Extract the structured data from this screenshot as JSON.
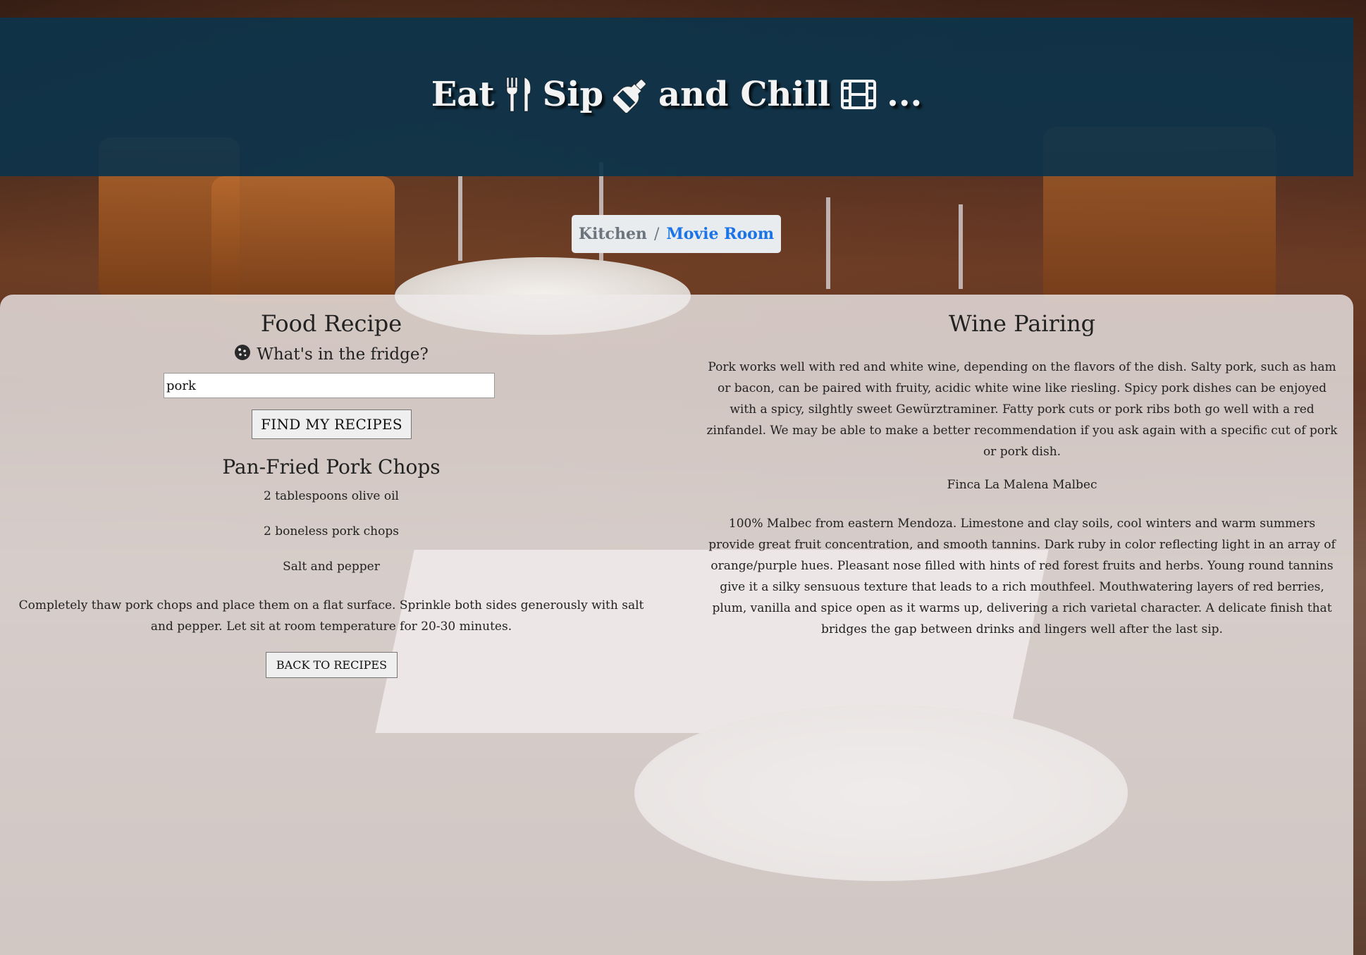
{
  "header": {
    "title_parts": [
      "Eat",
      "Sip",
      "and Chill",
      "..."
    ],
    "icons": [
      "fork-knife-icon",
      "wine-bottle-icon",
      "film-icon"
    ]
  },
  "breadcrumb": {
    "kitchen": "Kitchen",
    "separator": "/",
    "movie_room": "Movie Room"
  },
  "food": {
    "heading": "Food Recipe",
    "fridge_prompt": "What's in the fridge?",
    "search_value": "pork",
    "find_button": "FIND MY RECIPES",
    "recipe_title": "Pan-Fried Pork Chops",
    "ingredients": [
      "2 tablespoons olive oil",
      "2 boneless pork chops",
      "Salt and pepper"
    ],
    "instructions": "Completely thaw pork chops and place them on a flat surface. Sprinkle both sides generously with salt and pepper. Let sit at room temperature for 20-30 minutes.",
    "back_button": "BACK TO RECIPES"
  },
  "wine": {
    "heading": "Wine Pairing",
    "description": "Pork works well with red and white wine, depending on the flavors of the dish. Salty pork, such as ham or bacon, can be paired with fruity, acidic white wine like riesling. Spicy pork dishes can be enjoyed with a spicy, silghtly sweet Gewürztraminer. Fatty pork cuts or pork ribs both go well with a red zinfandel. We may be able to make a better recommendation if you ask again with a specific cut of pork or pork dish.",
    "wine_name": "Finca La Malena Malbec",
    "tasting_notes": "100% Malbec from eastern Mendoza. Limestone and clay soils, cool winters and warm summers provide great fruit concentration, and smooth tannins. Dark ruby in color reflecting light in an array of orange/purple hues. Pleasant nose filled with hints of red forest fruits and herbs. Young round tannins give it a silky sensuous texture that leads to a rich mouthfeel. Mouthwatering layers of red berries, plum, vanilla and spice open as it warms up, delivering a rich varietal character. A delicate finish that bridges the gap between drinks and lingers well after the last sip."
  },
  "colors": {
    "header_bg": "#0d344a",
    "link": "#1a73e8",
    "panel_bg": "#eeeaea"
  }
}
